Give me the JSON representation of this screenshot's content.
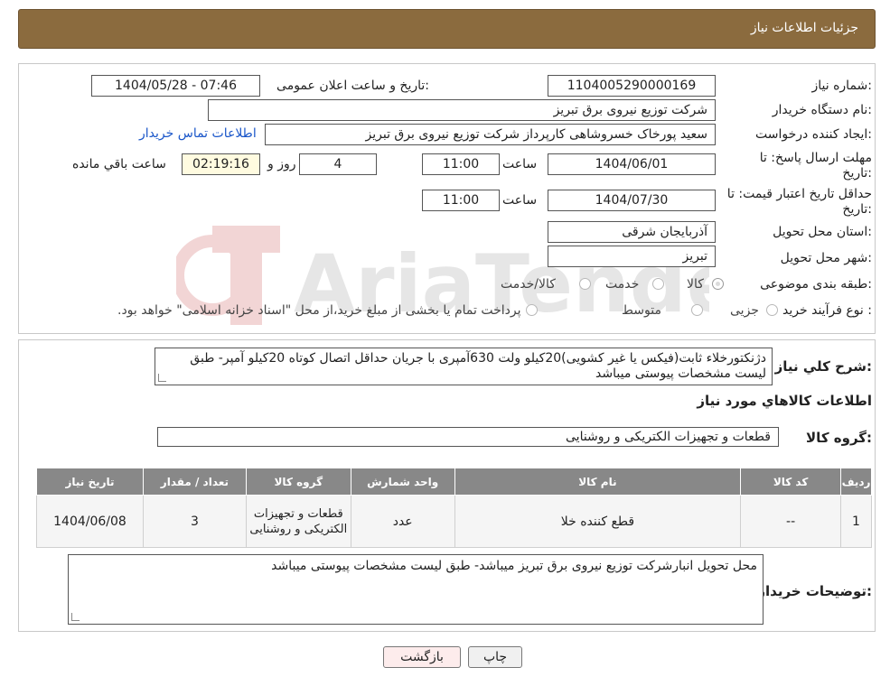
{
  "header": {
    "title": "جزئیات اطلاعات نیاز"
  },
  "fields": {
    "need_number_label": "شماره نیاز:",
    "need_number": "1104005290000169",
    "announce_label": "تاریخ و ساعت اعلان عمومی:",
    "announce_value": "1404/05/28 - 07:46",
    "buyer_org_label": "نام دستگاه خریدار:",
    "buyer_org": "شرکت توزیع نیروی برق تبریز",
    "creator_label": "ایجاد کننده درخواست:",
    "creator": "سعید پورخاک خسروشاهی کارپرداز شرکت توزیع نیروی برق تبریز",
    "contact_link": "اطلاعات تماس خریدار",
    "reply_deadline_label_1": "مهلت ارسال پاسخ: تا",
    "reply_deadline_label_2": "تاریخ:",
    "reply_date": "1404/06/01",
    "time_label": "ساعت",
    "reply_time": "11:00",
    "days_value": "4",
    "days_label": "روز و",
    "remaining_time": "02:19:16",
    "remaining_label": "ساعت باقي مانده",
    "validity_label_1": "حداقل تاریخ اعتبار قیمت: تا",
    "validity_label_2": "تاریخ:",
    "validity_date": "1404/07/30",
    "validity_time": "11:00",
    "province_label": "استان محل تحویل:",
    "province": "آذربایجان شرقی",
    "city_label": "شهر محل تحویل:",
    "city": "تبریز",
    "category_label": "طبقه بندی موضوعی:",
    "category_options": [
      "کالا",
      "خدمت",
      "کالا/خدمت"
    ],
    "process_label": "نوع فرآیند خرید :",
    "process_options": [
      "جزیی",
      "متوسط"
    ],
    "process_note": "پرداخت تمام یا بخشی از مبلغ خرید،از محل \"اسناد خزانه اسلامی\" خواهد بود."
  },
  "description": {
    "label": "شرح کلي نياز:",
    "text": "دژنکتورخلاء ثابت(فیکس یا غیر کشویی)20کیلو ولت 630آمپری با جریان حداقل اتصال کوتاه 20کیلو آمپر- طبق لیست مشخصات پیوستی میباشد"
  },
  "goods": {
    "section_title": "اطلاعات کالاهاي مورد نياز",
    "group_label": "گروه کالا:",
    "group_value": "قطعات و تجهیزات الکتریکی و روشنایی",
    "columns": [
      "رديف",
      "کد کالا",
      "نام کالا",
      "واحد شمارش",
      "گروه کالا",
      "تعداد / مقدار",
      "تاريخ نياز"
    ],
    "rows": [
      [
        "1",
        "--",
        "قطع کننده خلا",
        "عدد",
        "قطعات و تجهیزات الکتریکی و روشنایی",
        "3",
        "1404/06/08"
      ]
    ]
  },
  "notes": {
    "label": "توضیحات خریدار:",
    "text": "محل تحویل انبارشرکت توزیع نیروی برق تبریز میباشد- طبق لیست مشخصات پیوستی میباشد"
  },
  "buttons": {
    "print": "چاپ",
    "back": "بازگشت"
  },
  "watermark": {
    "text": "AriaTender.neT"
  },
  "colors": {
    "header_bg": "#8b6b3e",
    "table_header": "#888888",
    "link": "#1a56c9"
  }
}
